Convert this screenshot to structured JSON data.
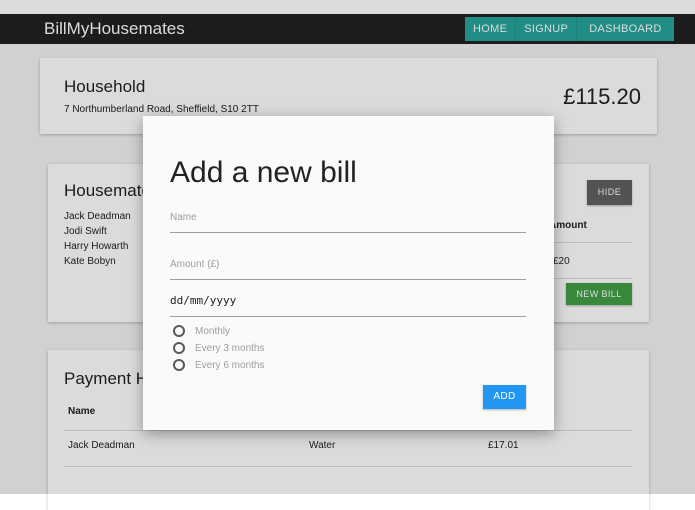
{
  "navbar": {
    "brand": "BillMyHousemates",
    "links": [
      "HOME",
      "SIGNUP",
      "DASHBOARD"
    ]
  },
  "household": {
    "title": "Household",
    "address": "7 Northumberland Road, Sheffield, S10 2TT",
    "total": "£115.20"
  },
  "housemates": {
    "title": "Housemates",
    "names": [
      "Jack Deadman",
      "Jodi Swift",
      "Harry Howarth",
      "Kate Bobyn"
    ],
    "hide_label": "HIDE",
    "amount_header": "Amount",
    "amount_value": "£20",
    "new_bill_label": "NEW BILL"
  },
  "payments": {
    "title": "Payment History",
    "name_header": "Name",
    "rows": [
      {
        "name": "Jack Deadman",
        "bill": "Water",
        "amount": "£17.01"
      }
    ]
  },
  "modal": {
    "title": "Add a new bill",
    "name_placeholder": "Name",
    "amount_placeholder": "Amount (£)",
    "date_placeholder": "dd/mm/yyyy",
    "frequency_options": [
      "Monthly",
      "Every 3 months",
      "Every 6 months"
    ],
    "add_label": "ADD"
  },
  "colors": {
    "navbar": "#212121",
    "nav_accent": "#26a69a",
    "hide_button": "#616161",
    "new_bill_button": "#43a047",
    "add_button": "#2196f3"
  }
}
